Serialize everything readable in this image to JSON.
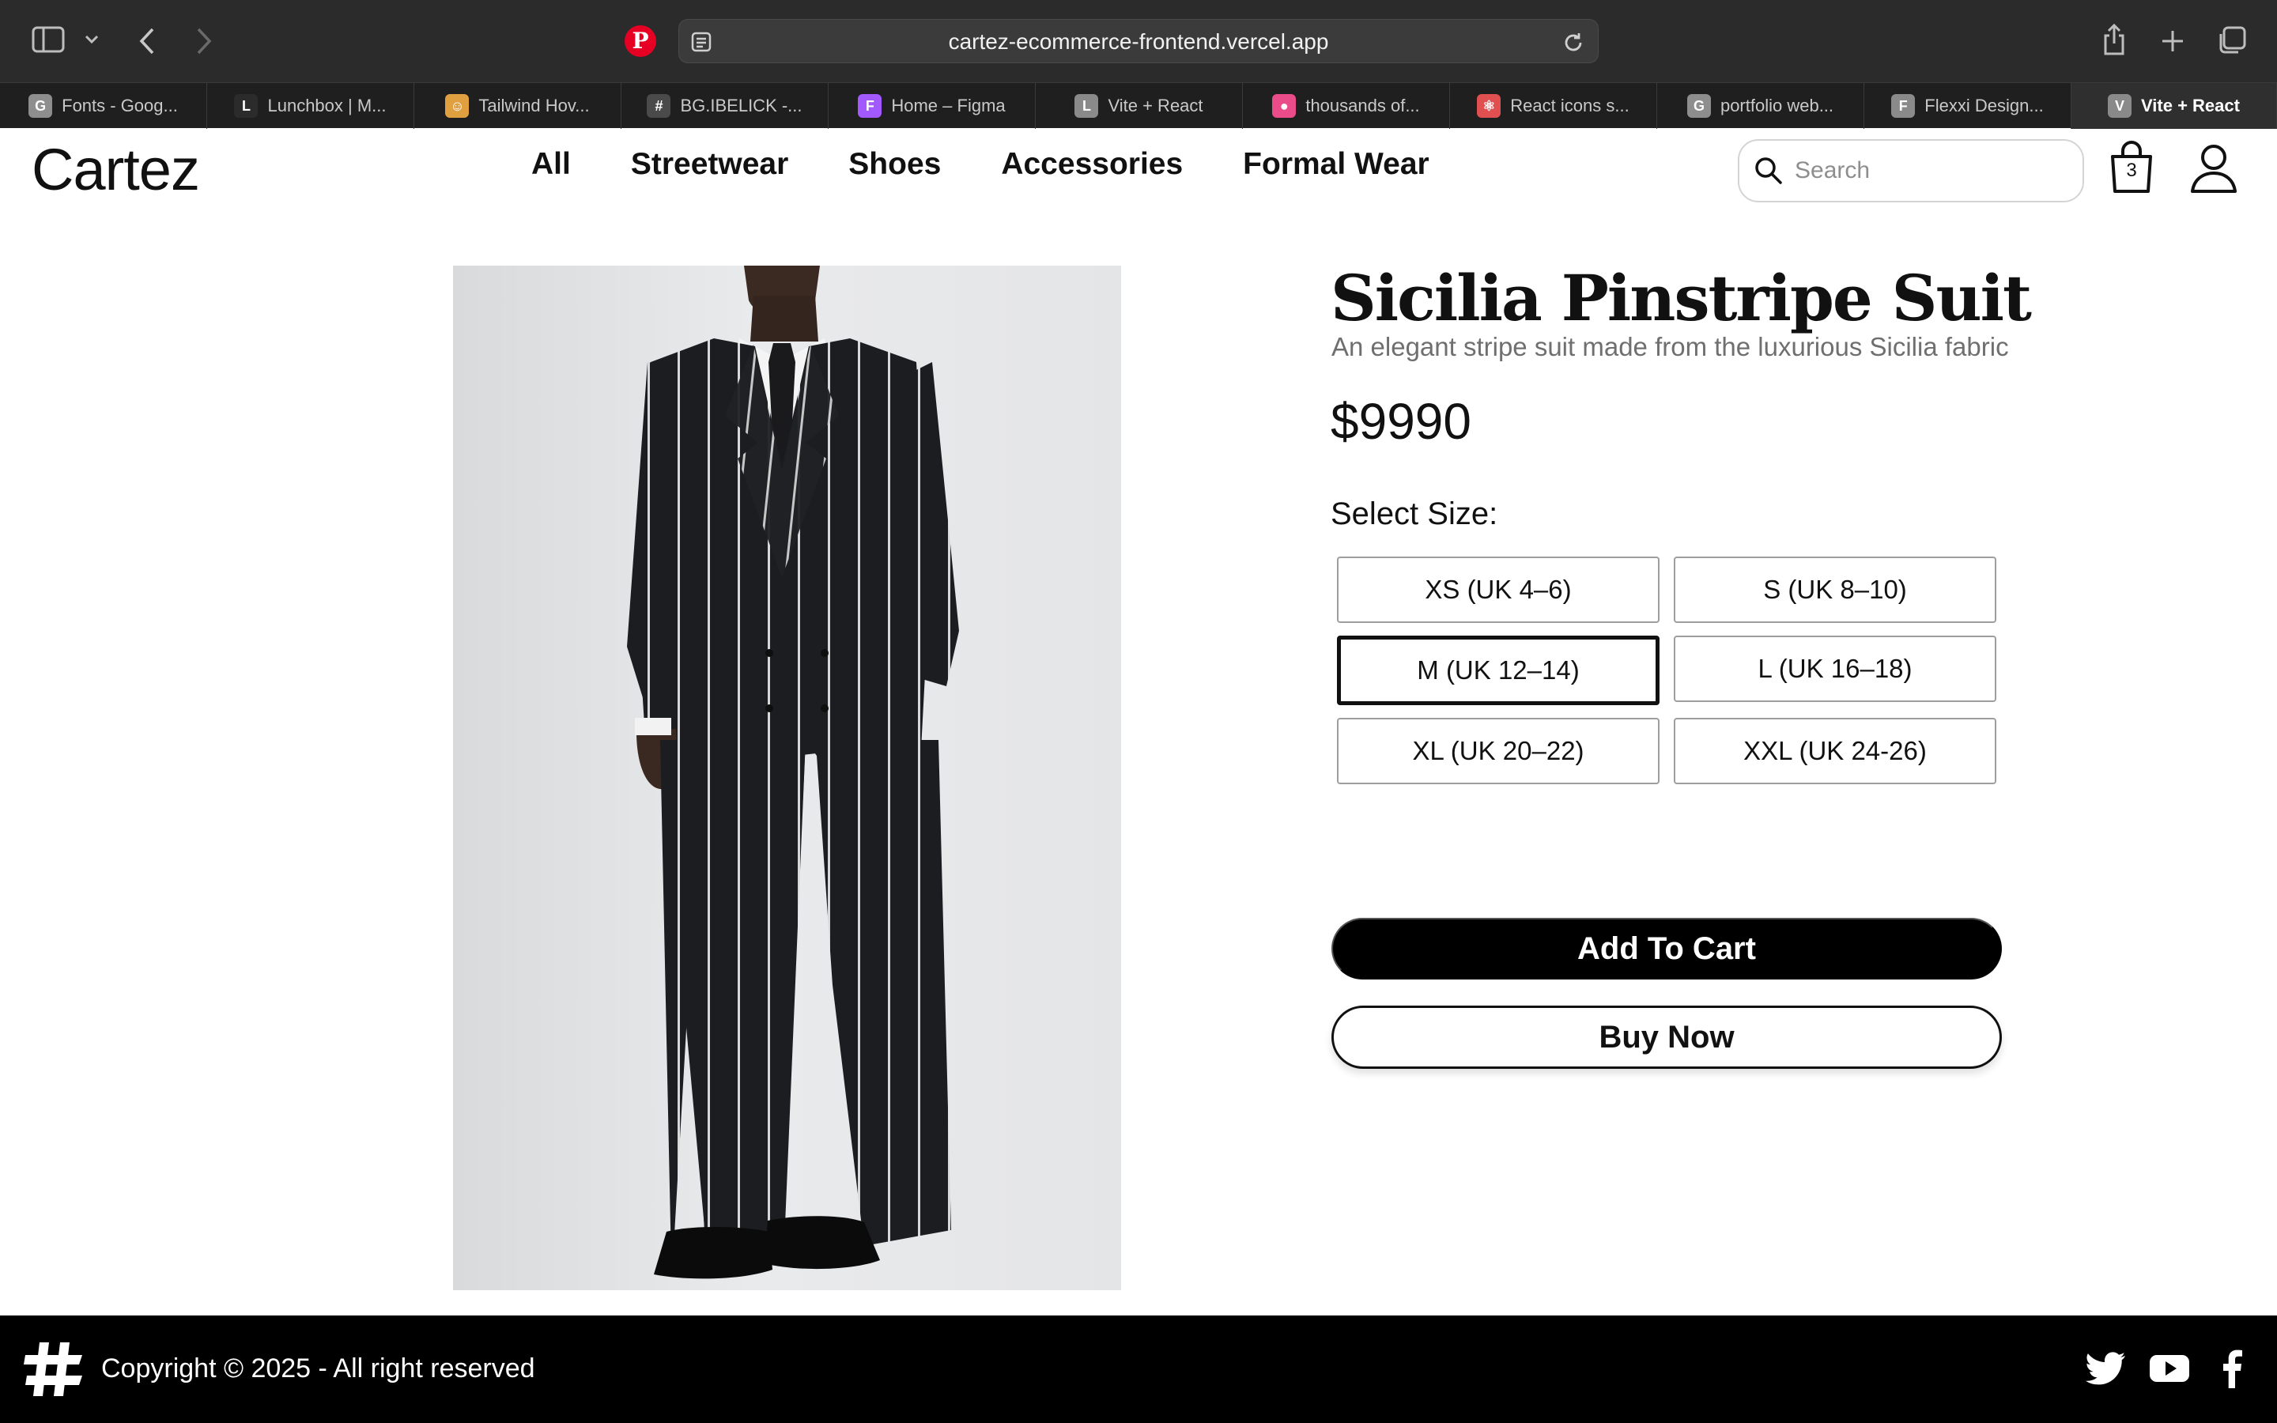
{
  "browser": {
    "url": "cartez-ecommerce-frontend.vercel.app",
    "tabs": [
      {
        "label": "Fonts - Goog...",
        "favicon": "G",
        "color": "#8e8e8e"
      },
      {
        "label": "Lunchbox | M...",
        "favicon": "L",
        "color": "#2b2b2b"
      },
      {
        "label": "Tailwind Hov...",
        "favicon": "☺",
        "color": "#e0a040"
      },
      {
        "label": "BG.IBELICK -...",
        "favicon": "#",
        "color": "#4a4a4a"
      },
      {
        "label": "Home – Figma",
        "favicon": "F",
        "color": "#a259ff"
      },
      {
        "label": "Vite + React",
        "favicon": "L",
        "color": "#8a8a8a"
      },
      {
        "label": "thousands of...",
        "favicon": "●",
        "color": "#ea4c89"
      },
      {
        "label": "React icons s...",
        "favicon": "⚛",
        "color": "#e05050"
      },
      {
        "label": "portfolio web...",
        "favicon": "G",
        "color": "#8e8e8e"
      },
      {
        "label": "Flexxi Design...",
        "favicon": "F",
        "color": "#8a8a8a"
      },
      {
        "label": "Vite + React",
        "favicon": "V",
        "color": "#8a8a8a",
        "active": true
      }
    ]
  },
  "site": {
    "logo": "Cartez",
    "nav": [
      "All",
      "Streetwear",
      "Shoes",
      "Accessories",
      "Formal Wear"
    ],
    "search_placeholder": "Search",
    "cart_count": "3"
  },
  "product": {
    "title": "Sicilia Pinstripe Suit",
    "subtitle": "An elegant stripe suit made from the luxurious Sicilia fabric",
    "price": "$9990",
    "size_label": "Select Size:",
    "sizes": [
      "XS (UK 4–6)",
      "S (UK 8–10)",
      "M (UK 12–14)",
      "L (UK 16–18)",
      "XL (UK 20–22)",
      "XXL (UK 24-26)"
    ],
    "selected_size": "M (UK 12–14)",
    "add_to_cart": "Add To Cart",
    "buy_now": "Buy Now"
  },
  "footer": {
    "copyright": "Copyright © 2025 - All right reserved"
  },
  "icons": [
    "sidebar-icon",
    "chevron-down-icon",
    "back-icon",
    "forward-icon",
    "pinterest-icon",
    "reader-icon",
    "reload-icon",
    "share-icon",
    "new-tab-icon",
    "tab-overview-icon",
    "search-icon",
    "shopping-bag-icon",
    "user-icon",
    "hashtag-logo-icon",
    "twitter-icon",
    "youtube-icon",
    "facebook-icon"
  ]
}
